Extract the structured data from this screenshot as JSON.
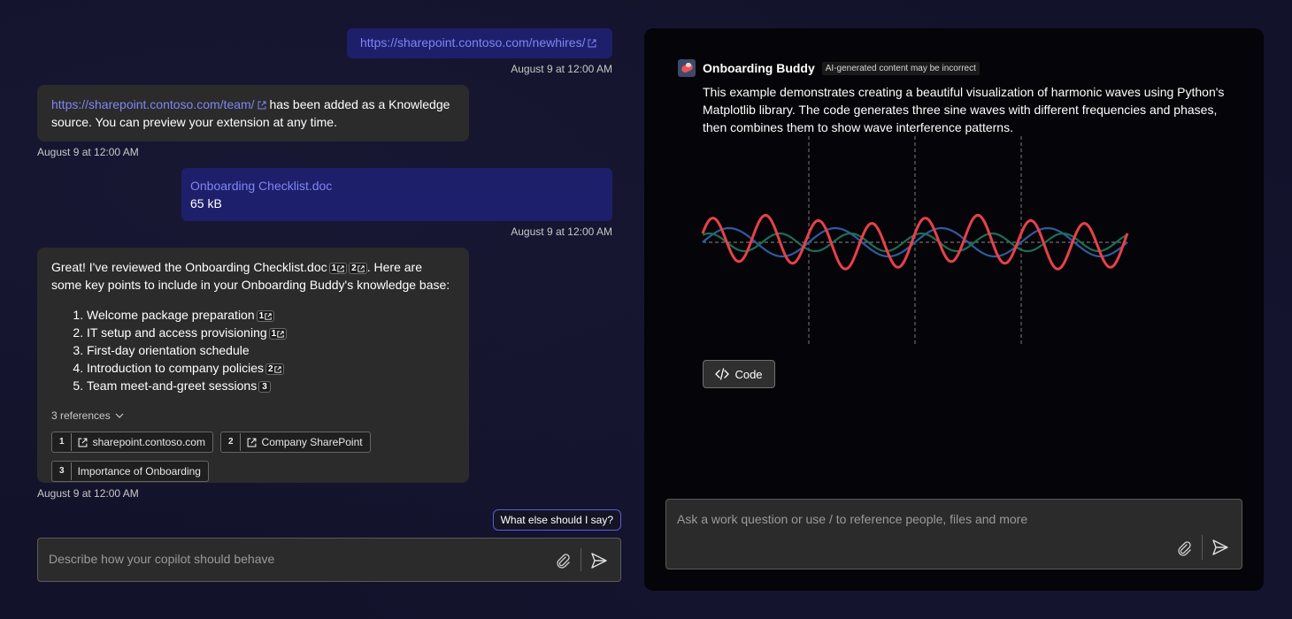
{
  "chat": {
    "messages": [
      {
        "type": "user-link",
        "text": "https://sharepoint.contoso.com/newhires/",
        "timestamp": "August 9 at 12:00 AM"
      },
      {
        "type": "bot",
        "link": "https://sharepoint.contoso.com/team/",
        "text_after": " has been added as a Knowledge source. You can preview your extension at any time.",
        "timestamp": "August 9 at 12:00 AM"
      },
      {
        "type": "user-file",
        "file_name": "Onboarding Checklist.doc",
        "file_size": "65 kB",
        "timestamp": "August 9 at 12:00 AM"
      },
      {
        "type": "bot",
        "intro_part1": "Great! I've reviewed the Onboarding Checklist.doc",
        "intro_part2": ". Here are some key points to include in your Onboarding Buddy's knowledge base:",
        "points": [
          {
            "text": "Welcome package preparation",
            "cite": "1"
          },
          {
            "text": "IT setup and access provisioning",
            "cite": "1"
          },
          {
            "text": "First-day orientation schedule",
            "cite": ""
          },
          {
            "text": "Introduction to company policies",
            "cite": "2"
          },
          {
            "text": "Team meet-and-greet sessions",
            "cite": "3"
          }
        ],
        "references_label": "3 references",
        "references": [
          {
            "num": "1",
            "label": "sharepoint.contoso.com",
            "external": true
          },
          {
            "num": "2",
            "label": "Company SharePoint",
            "external": true
          },
          {
            "num": "3",
            "label": "Importance of Onboarding",
            "external": false
          }
        ],
        "timestamp": "August 9 at 12:00 AM"
      }
    ],
    "suggestion": "What else should I say?",
    "input_placeholder": "Describe how your copilot should behave"
  },
  "preview": {
    "bot_name": "Onboarding Buddy",
    "ai_badge": "AI-generated content may be incorrect",
    "description": "This example demonstrates creating a beautiful visualization of harmonic waves using Python's Matplotlib library. The code generates three sine waves with different frequencies and phases, then combines them to show wave interference patterns.",
    "code_button": "Code",
    "input_placeholder": "Ask a work question or use / to reference people, files and more",
    "colors": {
      "red": "#e8404a",
      "blue": "#2e5c9e",
      "green": "#1f6e55"
    }
  },
  "chart_data": {
    "type": "line",
    "title": "",
    "xlabel": "",
    "ylabel": "",
    "xlim": [
      0,
      4
    ],
    "ylim": [
      -2,
      2
    ],
    "series": [
      {
        "color": "#2e5c9e",
        "amplitude": 0.4,
        "frequency": 1,
        "phase": 0
      },
      {
        "color": "#1f6e55",
        "amplitude": 0.25,
        "frequency": 1.5,
        "phase": 1.0
      },
      {
        "color": "#e8404a",
        "amplitude": 0.65,
        "frequency": 2,
        "phase": 0.4
      }
    ],
    "vertical_gridlines": [
      1,
      2,
      3
    ],
    "horizontal_gridline": 0,
    "icons": {
      "external": "external-link-icon",
      "attach": "paperclip-icon",
      "send": "send-icon",
      "code": "code-icon",
      "chevron": "chevron-down-icon"
    }
  }
}
